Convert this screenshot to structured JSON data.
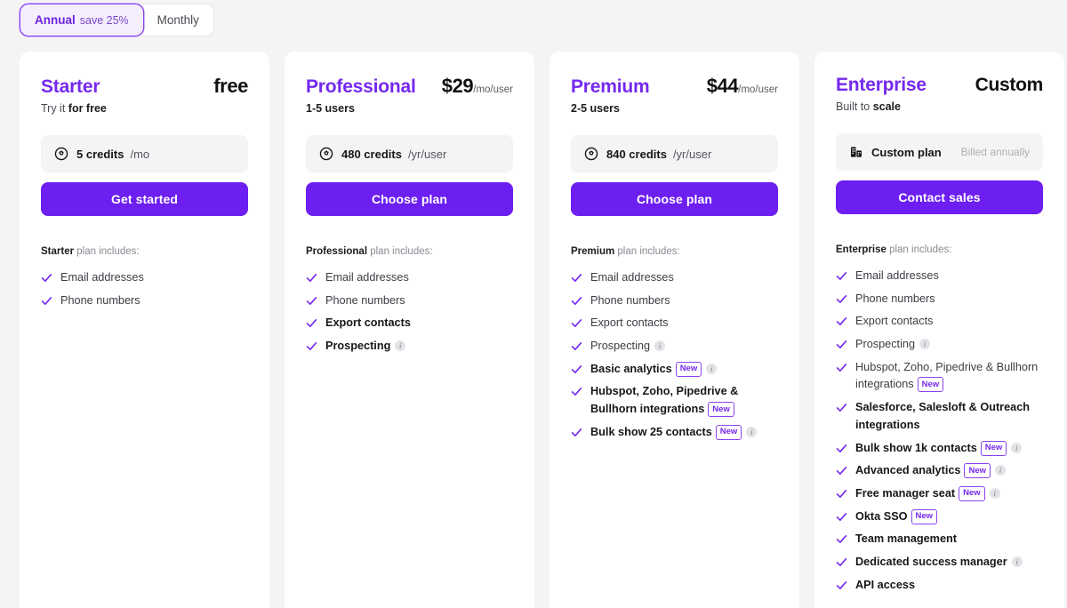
{
  "billing_toggle": {
    "options": [
      {
        "label": "Annual",
        "note": "save 25%",
        "active": true
      },
      {
        "label": "Monthly",
        "note": "",
        "active": false
      }
    ]
  },
  "colors": {
    "brand_purple": "#7528ef",
    "cta_purple": "#6d1ef0",
    "page_bg": "#f4f4f5",
    "card_bg": "#ffffff",
    "badge_border": "#8b43f0"
  },
  "plans": [
    {
      "name": "Starter",
      "price_amount": "free",
      "price_unit": "",
      "sub_prefix": "Try it ",
      "sub_bold": "for free",
      "sub_all_bold": false,
      "credits_icon": "credit-coin-icon",
      "credits_amount": "5 credits",
      "credits_period": "/mo",
      "credits_right": "",
      "cta_label": "Get started",
      "includes_plan": "Starter",
      "includes_suffix": " plan includes:",
      "features": [
        {
          "text": "Email addresses",
          "bold": false,
          "badge": "",
          "info": false
        },
        {
          "text": "Phone numbers",
          "bold": false,
          "badge": "",
          "info": false
        }
      ]
    },
    {
      "name": "Professional",
      "price_amount": "$29",
      "price_unit": "/mo/user",
      "sub_prefix": "",
      "sub_bold": "1-5 users",
      "sub_all_bold": true,
      "credits_icon": "credit-coin-icon",
      "credits_amount": "480 credits",
      "credits_period": "/yr/user",
      "credits_right": "",
      "cta_label": "Choose plan",
      "includes_plan": "Professional",
      "includes_suffix": " plan includes:",
      "features": [
        {
          "text": "Email addresses",
          "bold": false,
          "badge": "",
          "info": false
        },
        {
          "text": "Phone numbers",
          "bold": false,
          "badge": "",
          "info": false
        },
        {
          "text": "Export contacts",
          "bold": true,
          "badge": "",
          "info": false
        },
        {
          "text": "Prospecting",
          "bold": true,
          "badge": "",
          "info": true
        }
      ]
    },
    {
      "name": "Premium",
      "price_amount": "$44",
      "price_unit": "/mo/user",
      "sub_prefix": "",
      "sub_bold": "2-5 users",
      "sub_all_bold": true,
      "credits_icon": "credit-coin-icon",
      "credits_amount": "840 credits",
      "credits_period": "/yr/user",
      "credits_right": "",
      "cta_label": "Choose plan",
      "includes_plan": "Premium",
      "includes_suffix": " plan includes:",
      "features": [
        {
          "text": "Email addresses",
          "bold": false,
          "badge": "",
          "info": false
        },
        {
          "text": "Phone numbers",
          "bold": false,
          "badge": "",
          "info": false
        },
        {
          "text": "Export contacts",
          "bold": false,
          "badge": "",
          "info": false
        },
        {
          "text": "Prospecting",
          "bold": false,
          "badge": "",
          "info": true
        },
        {
          "text": "Basic analytics",
          "bold": true,
          "badge": "New",
          "info": true
        },
        {
          "text": "Hubspot, Zoho, Pipedrive & Bullhorn integrations",
          "bold": true,
          "badge": "New",
          "info": false
        },
        {
          "text": "Bulk show 25 contacts",
          "bold": true,
          "badge": "New",
          "info": true
        }
      ]
    },
    {
      "name": "Enterprise",
      "price_amount": "Custom",
      "price_unit": "",
      "sub_prefix": "Built to ",
      "sub_bold": "scale",
      "sub_all_bold": false,
      "credits_icon": "building-icon",
      "credits_amount": "Custom plan",
      "credits_period": "",
      "credits_right": "Billed annually",
      "cta_label": "Contact sales",
      "includes_plan": "Enterprise",
      "includes_suffix": " plan includes:",
      "features": [
        {
          "text": "Email addresses",
          "bold": false,
          "badge": "",
          "info": false
        },
        {
          "text": "Phone numbers",
          "bold": false,
          "badge": "",
          "info": false
        },
        {
          "text": "Export contacts",
          "bold": false,
          "badge": "",
          "info": false
        },
        {
          "text": "Prospecting",
          "bold": false,
          "badge": "",
          "info": true
        },
        {
          "text": "Hubspot, Zoho, Pipedrive & Bullhorn integrations",
          "bold": false,
          "badge": "New",
          "info": false
        },
        {
          "text": "Salesforce, Salesloft & Outreach integrations",
          "bold": true,
          "badge": "",
          "info": false
        },
        {
          "text": "Bulk show 1k contacts",
          "bold": true,
          "badge": "New",
          "info": true
        },
        {
          "text": "Advanced analytics",
          "bold": true,
          "badge": "New",
          "info": true
        },
        {
          "text": "Free manager seat",
          "bold": true,
          "badge": "New",
          "info": true
        },
        {
          "text": "Okta SSO",
          "bold": true,
          "badge": "New",
          "info": false
        },
        {
          "text": "Team management",
          "bold": true,
          "badge": "",
          "info": false
        },
        {
          "text": "Dedicated success manager",
          "bold": true,
          "badge": "",
          "info": true
        },
        {
          "text": "API access",
          "bold": true,
          "badge": "",
          "info": false
        }
      ]
    }
  ]
}
